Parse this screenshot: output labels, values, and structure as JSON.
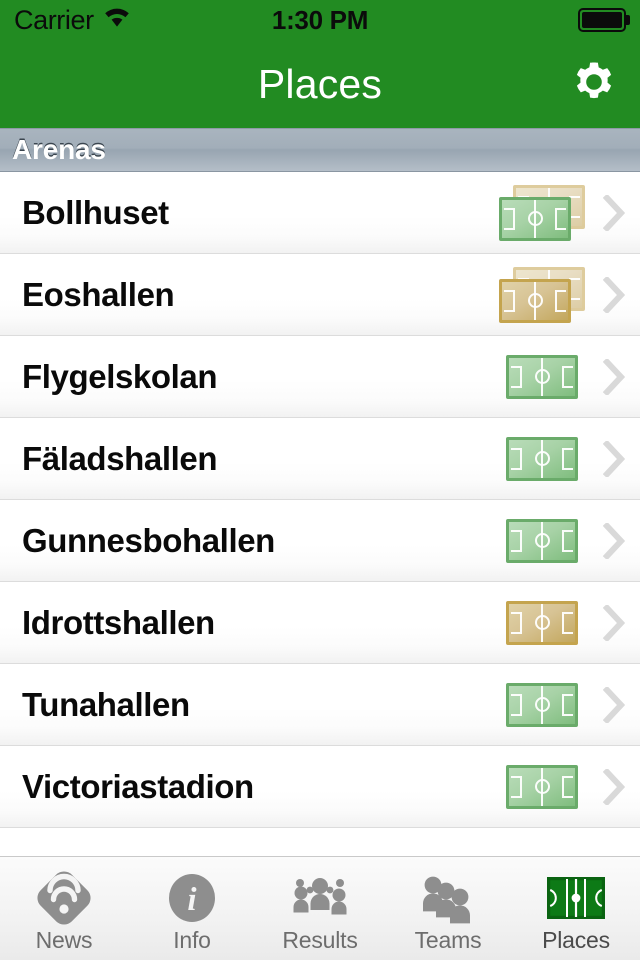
{
  "status_bar": {
    "carrier": "Carrier",
    "wifi_icon": "wifi-icon",
    "time": "1:30 PM",
    "battery_icon": "battery-full-icon"
  },
  "nav_bar": {
    "title": "Places",
    "settings_icon": "gear-icon"
  },
  "colors": {
    "brand_green": "#228b22",
    "section_header": "#a2aeb9",
    "pitch_green": "#6aab6a",
    "pitch_tan": "#c4a44e",
    "tab_active": "#0a7a0a",
    "tab_inactive": "#8e8e8e"
  },
  "list": {
    "section_title": "Arenas",
    "rows": [
      {
        "name": "Bollhuset",
        "icon": "pitch-stack-green-on-tan",
        "disclosure_icon": "chevron-right-icon"
      },
      {
        "name": "Eoshallen",
        "icon": "pitch-stack-tan",
        "disclosure_icon": "chevron-right-icon"
      },
      {
        "name": "Flygelskolan",
        "icon": "pitch-single-green",
        "disclosure_icon": "chevron-right-icon"
      },
      {
        "name": "Fäladshallen",
        "icon": "pitch-single-green",
        "disclosure_icon": "chevron-right-icon"
      },
      {
        "name": "Gunnesbohallen",
        "icon": "pitch-single-green",
        "disclosure_icon": "chevron-right-icon"
      },
      {
        "name": "Idrottshallen",
        "icon": "pitch-single-tan",
        "disclosure_icon": "chevron-right-icon"
      },
      {
        "name": "Tunahallen",
        "icon": "pitch-single-green",
        "disclosure_icon": "chevron-right-icon"
      },
      {
        "name": "Victoriastadion",
        "icon": "pitch-single-green",
        "disclosure_icon": "chevron-right-icon"
      }
    ]
  },
  "tab_bar": {
    "items": [
      {
        "label": "News",
        "icon": "rss-icon",
        "active": false
      },
      {
        "label": "Info",
        "icon": "info-icon",
        "active": false
      },
      {
        "label": "Results",
        "icon": "crowd-icon",
        "active": false
      },
      {
        "label": "Teams",
        "icon": "people-icon",
        "active": false
      },
      {
        "label": "Places",
        "icon": "pitch-icon",
        "active": true
      }
    ]
  }
}
